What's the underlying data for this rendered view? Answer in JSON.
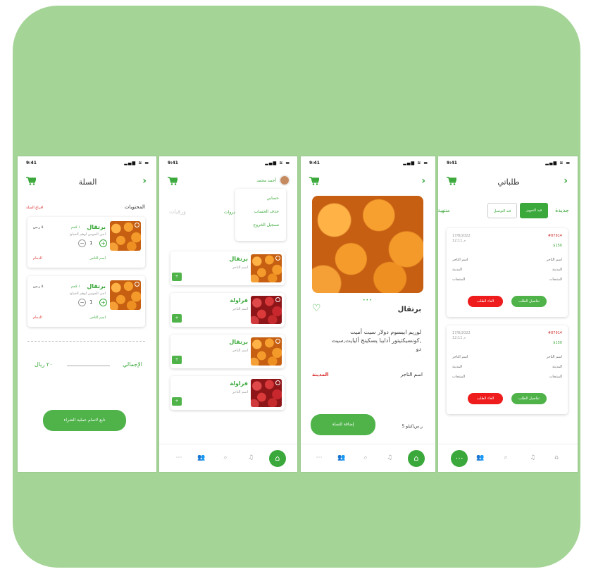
{
  "status": {
    "time": "9:41",
    "signal": "▂▄▆ ≋ ▬"
  },
  "cart_screen": {
    "title": "السلة",
    "contents_label": "المحتويات",
    "empty_cart": "افراغ السلة",
    "items": [
      {
        "name": "برتقال",
        "price": "١ كجم",
        "unit": "٥ ر.س",
        "desc": "اجي الحوس لوهم الحبائ",
        "qty": "1",
        "merchant": "اسم التاجر",
        "city": "الدمام"
      },
      {
        "name": "برتقال",
        "price": "١ كجم",
        "unit": "٥ ر.س",
        "desc": "اجي الحوس لوهم الحبائ",
        "qty": "1",
        "merchant": "اسم التاجر",
        "city": "الدمام"
      }
    ],
    "total_label": "الإجمالي",
    "total_value": "٢٠ ريال",
    "checkout": "تابع لاتمام عملية الشراء"
  },
  "home_screen": {
    "user": "أحمد محمد",
    "menu": [
      "حسابي",
      "حذف الحساب",
      "تسجيل الخروج"
    ],
    "categories": [
      "فواكه",
      "خضروات",
      "ورقيات"
    ],
    "products": [
      {
        "name": "برتقال",
        "meta": "اسم التاجر"
      },
      {
        "name": "فراولة",
        "meta": "اسم التاجر"
      },
      {
        "name": "برتقال",
        "meta": "اسم التاجر"
      },
      {
        "name": "فراولة",
        "meta": "اسم التاجر"
      }
    ]
  },
  "detail_screen": {
    "name": "برتقال",
    "desc": "لوريم ايبسوم دولار سيت أميت ,كونسيكتيتور أدايبا يسكينج أليايت,سيت دو",
    "merchant_label": "اسم التاجر",
    "city_label": "المدينة",
    "price": "5 ر.س/كيلو",
    "add": "إضافة للسلة"
  },
  "orders_screen": {
    "title": "طلباتي",
    "tabs": [
      "جديدة",
      "قيد التجهيز",
      "قيد التوصيل",
      "منتهية"
    ],
    "orders": [
      {
        "id": "#87914",
        "date": "17/8/2022",
        "time": "12:11 م",
        "total": "$150",
        "rows": [
          "اسم التاجر",
          "المدينة",
          "المنتجات"
        ],
        "details": "تفاصيل الطلب",
        "cancel": "الغاء الطلب"
      },
      {
        "id": "#87914",
        "date": "17/8/2022",
        "time": "12:11 م",
        "total": "$150",
        "rows": [
          "اسم التاجر",
          "المدينة",
          "المنتجات"
        ],
        "details": "تفاصيل الطلب",
        "cancel": "الغاء الطلب"
      }
    ]
  },
  "colors": {
    "bg": "#a5d497",
    "accent": "#3aa83a",
    "cancel": "#ee1c1c"
  }
}
